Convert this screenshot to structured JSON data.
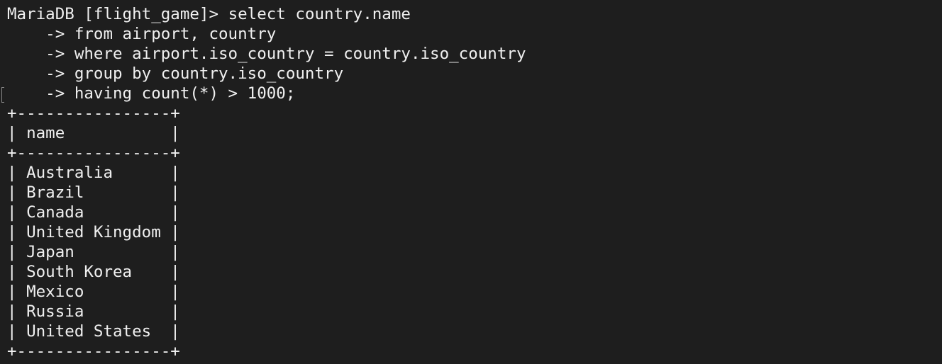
{
  "terminal": {
    "prompt": "MariaDB [flight_game]> ",
    "query": [
      "select country.name",
      "    -> from airport, country",
      "    -> where airport.iso_country = country.iso_country",
      "    -> group by country.iso_country",
      "    -> having count(*) > 1000;"
    ],
    "table": {
      "border": "+----------------+",
      "header": "| name           |",
      "rows": [
        "| Australia      |",
        "| Brazil         |",
        "| Canada         |",
        "| United Kingdom |",
        "| Japan          |",
        "| South Korea    |",
        "| Mexico         |",
        "| Russia         |",
        "| United States  |"
      ]
    },
    "colors": {
      "background": "#1e1e1e",
      "text": "#f0f0f0"
    }
  }
}
